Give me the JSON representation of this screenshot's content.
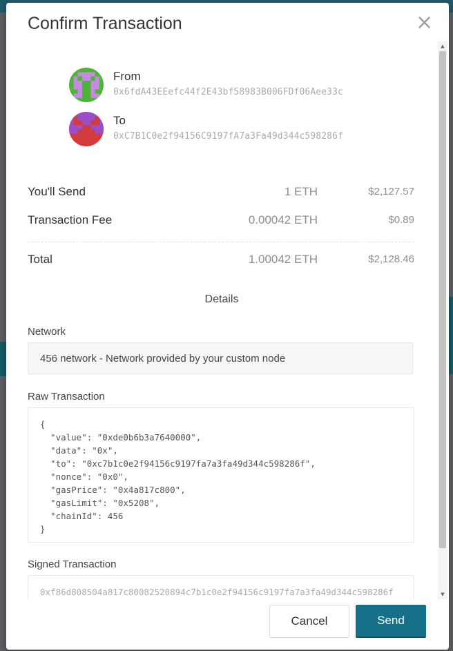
{
  "modal": {
    "title": "Confirm Transaction",
    "close_icon": "close-icon"
  },
  "from": {
    "label": "From",
    "address": "0x6fdA43EEefc44f2E43bf58983B006FDf06Aee33c",
    "avatar_colors": [
      "#4fb33a",
      "#c58be0"
    ]
  },
  "to": {
    "label": "To",
    "address": "0xC7B1C0e2f94156C9197fA7a3Fa49d344c598286f",
    "avatar_colors": [
      "#d23b3b",
      "#9b4fc7"
    ]
  },
  "summary": {
    "send": {
      "label": "You'll Send",
      "amount": "1 ETH",
      "usd": "$2,127.57"
    },
    "fee": {
      "label": "Transaction Fee",
      "amount": "0.00042 ETH",
      "usd": "$0.89"
    },
    "total": {
      "label": "Total",
      "amount": "1.00042 ETH",
      "usd": "$2,128.46"
    }
  },
  "details": {
    "heading": "Details",
    "network_label": "Network",
    "network_value": "456 network - Network provided by your custom node",
    "raw_label": "Raw Transaction",
    "raw_value": "{\n  \"value\": \"0xde0b6b3a7640000\",\n  \"data\": \"0x\",\n  \"to\": \"0xc7b1c0e2f94156c9197fa7a3fa49d344c598286f\",\n  \"nonce\": \"0x0\",\n  \"gasPrice\": \"0x4a817c800\",\n  \"gasLimit\": \"0x5208\",\n  \"chainId\": 456\n}",
    "signed_label": "Signed Transaction",
    "signed_value": "0xf86d808504a817c80082520894c7b1c0e2f94156c9197fa7a3fa49d344c598286f"
  },
  "buttons": {
    "cancel": "Cancel",
    "send": "Send"
  },
  "colors": {
    "accent": "#16708a",
    "muted": "#8a8f94"
  }
}
